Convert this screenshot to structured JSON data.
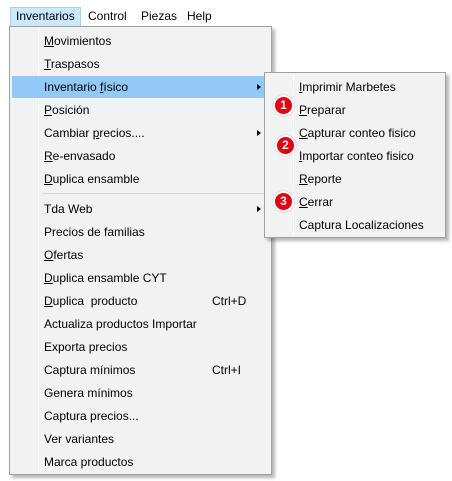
{
  "menubar": {
    "items": [
      {
        "label": "Inventarios"
      },
      {
        "label": "Control"
      },
      {
        "label": "Piezas"
      },
      {
        "label": "Help"
      }
    ]
  },
  "main_menu": {
    "items": [
      {
        "label_u": "M",
        "label_rest": "ovimientos"
      },
      {
        "label_u": "T",
        "label_rest": "raspasos"
      },
      {
        "label_pre": "Inventario ",
        "label_u": "f",
        "label_rest": "ísico"
      },
      {
        "label_pre": "",
        "label_u": "P",
        "label_rest": "osición"
      },
      {
        "label_pre": "Cambiar ",
        "label_u": "p",
        "label_rest": "recios...."
      },
      {
        "label_pre": "",
        "label_u": "R",
        "label_rest": "e-envasado"
      },
      {
        "label_pre": "",
        "label_u": "D",
        "label_rest": "uplica ensamble"
      },
      {
        "label": "Tda Web"
      },
      {
        "label": "Precios de familias"
      },
      {
        "label_u": "O",
        "label_rest": "fertas"
      },
      {
        "label_u": "D",
        "label_rest": "uplica ensamble CYT"
      },
      {
        "label_u": "D",
        "label_rest": "uplica  producto",
        "shortcut": "Ctrl+D"
      },
      {
        "label": "Actualiza productos Importar"
      },
      {
        "label": "Exporta precios"
      },
      {
        "label": "Captura mínimos",
        "shortcut": "Ctrl+I"
      },
      {
        "label": "Genera mínimos"
      },
      {
        "label": "Captura precios..."
      },
      {
        "label": "Ver variantes"
      },
      {
        "label": "Marca productos"
      }
    ]
  },
  "submenu": {
    "items": [
      {
        "label_u": "I",
        "label_rest": "mprimir Marbetes"
      },
      {
        "label_u": "P",
        "label_rest": "reparar"
      },
      {
        "label_u": "C",
        "label_rest": "apturar conteo fisico"
      },
      {
        "label_u": "I",
        "label_rest": "mportar conteo fisico"
      },
      {
        "label_u": "R",
        "label_rest": "eporte"
      },
      {
        "label_u": "C",
        "label_rest": "errar"
      },
      {
        "label": "Captura Localizaciones"
      }
    ]
  },
  "badges": [
    "1",
    "2",
    "3"
  ],
  "colors": {
    "highlight": "#91c9f7",
    "menubar_active": "#cce8ff",
    "badge": "#e60012"
  }
}
